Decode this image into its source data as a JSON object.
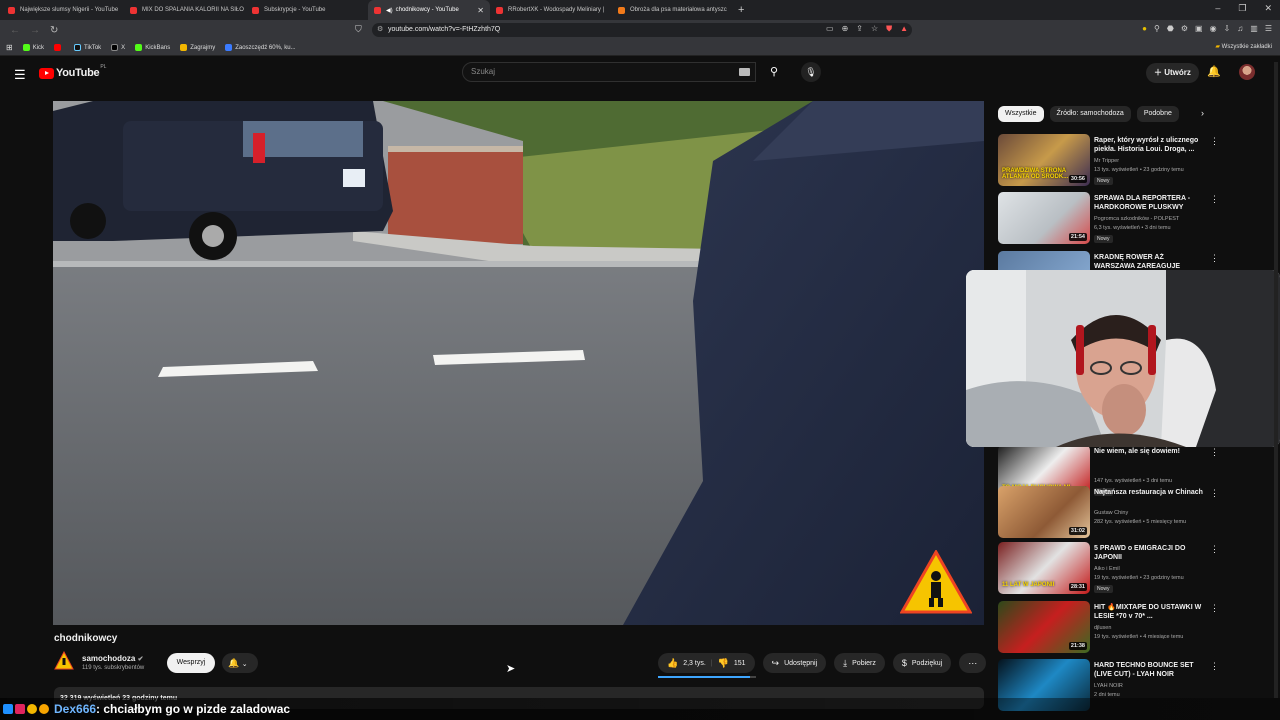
{
  "browser": {
    "tabs": [
      {
        "label": "Największe slumsy Nigerii - YouTube",
        "active": false
      },
      {
        "label": "MIX DO SPALANIA KALORII NA SIŁO",
        "active": false
      },
      {
        "label": "Subskrypcje - YouTube",
        "active": false
      },
      {
        "label": "chodnikowcy - YouTube",
        "active": true
      },
      {
        "label": "RRobertXK - Wodospady Meliniary |",
        "active": false
      },
      {
        "label": "Obroża dla psa materiałowa antyszc",
        "active": false
      }
    ],
    "url": "youtube.com/watch?v=-FtHZzhth7Q",
    "bookmarks": [
      "Kick",
      "TikTok",
      "X",
      "KickBans",
      "Zagrajmy",
      "Zaoszczędź 60%, ku..."
    ],
    "all_bookmarks": "Wszystkie zakładki"
  },
  "youtube": {
    "logo_text": "YouTube",
    "region": "PL",
    "search_placeholder": "Szukaj",
    "create_label": "Utwórz"
  },
  "video": {
    "title": "chodnikowcy",
    "channel": "samochodoza",
    "subscribers": "119 tys. subskrybentów",
    "support_label": "Wesprzyj",
    "likes": "2,3 tys.",
    "dislikes": "151",
    "like_ratio": 0.94,
    "share_label": "Udostępnij",
    "download_label": "Pobierz",
    "thanks_label": "Podziękuj",
    "stats_text": "32 319 wyświetleń  23 godziny temu"
  },
  "sidebar": {
    "chips": [
      "Wszystkie",
      "Źródło: samochodoza",
      "Podobne"
    ],
    "recs": [
      {
        "title": "Raper, który wyrósł z ulicznego piekła. Historia Loui. Droga, ...",
        "channel": "Mr Tripper",
        "meta": "13 tys. wyświetleń • 23 godziny temu",
        "badge": "Nowy",
        "duration": "30:56",
        "thumb_text": "PRAWDZIWA STRONA ATLANTA OD ŚRODK..."
      },
      {
        "title": "SPRAWA DLA REPORTERA - HARDKOROWE PLUSKWY",
        "channel": "Pogromca szkodników - POLPEST",
        "meta": "6,3 tys. wyświetleń • 3 dni temu",
        "badge": "Nowy",
        "duration": "21:54",
        "thumb_text": ""
      },
      {
        "title": "KRADNĘ ROWER AŻ WARSZAWA ZAREAGUJE",
        "channel": "",
        "meta": "",
        "badge": "",
        "duration": "",
        "thumb_text": ""
      },
      {
        "title": "Nie wiem, ale się dowiem!",
        "channel": "",
        "meta": "147 tys. wyświetleń • 3 dni temu",
        "badge": "Nowy",
        "duration": "37:57",
        "thumb_text": "TO MOJA DUCHOWA MI..."
      },
      {
        "title": "Najtańsza restauracja w Chinach",
        "channel": "Gustaw Chiny",
        "meta": "282 tys. wyświetleń • 5 miesięcy temu",
        "badge": "",
        "duration": "31:02",
        "thumb_text": ""
      },
      {
        "title": "5 PRAWD o EMIGRACJI DO JAPONII",
        "channel": "Aiko i Emil",
        "meta": "19 tys. wyświetleń • 23 godziny temu",
        "badge": "Nowy",
        "duration": "28:31",
        "thumb_text": "11 LAT W JAPONII"
      },
      {
        "title": "HIT 🔥MIXTAPE DO USTAWKI W LESIE *70 v 70* ...",
        "channel": "djlusen",
        "meta": "19 tys. wyświetleń • 4 miesiące temu",
        "badge": "",
        "duration": "21:38",
        "thumb_text": ""
      },
      {
        "title": "HARD TECHNO BOUNCE SET (LIVE CUT) - LYAH NOIR",
        "channel": "LYAH NOIR",
        "meta": "2 dni temu",
        "badge": "",
        "duration": "",
        "thumb_text": ""
      }
    ]
  },
  "chat": {
    "user": "Dex666",
    "message": ": chciałbym go w pizde zaladowac"
  },
  "colors": {
    "accent": "#ff0000",
    "link": "#3ea6ff",
    "chat_user": "#6fb6ff"
  }
}
